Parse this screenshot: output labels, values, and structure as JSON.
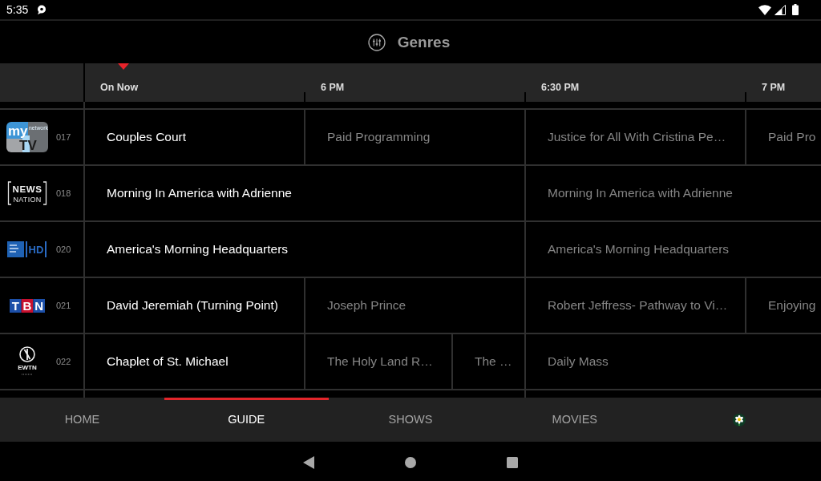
{
  "status_bar": {
    "time": "5:35"
  },
  "header": {
    "filter_label": "Genres"
  },
  "timeline": [
    {
      "label": "On Now"
    },
    {
      "label": "6 PM"
    },
    {
      "label": "6:30 PM"
    },
    {
      "label": "7 PM"
    }
  ],
  "channels": [
    {
      "number": "017",
      "logo": {
        "kind": "tile",
        "texts": [
          "my",
          "network",
          "TV"
        ]
      },
      "programs": [
        {
          "title": "Couples Court",
          "kind": "half",
          "airing": true
        },
        {
          "title": "Paid Programming",
          "kind": "half",
          "airing": false
        },
        {
          "title": "Justice for All With Cristina Pe…",
          "kind": "half",
          "airing": false
        },
        {
          "title": "Paid Pro",
          "kind": "open",
          "airing": false
        }
      ]
    },
    {
      "number": "018",
      "logo": {
        "kind": "frame",
        "texts": [
          "NEWS",
          "NATION"
        ]
      },
      "programs": [
        {
          "title": "Morning In America with Adrienne",
          "kind": "hour",
          "airing": true
        },
        {
          "title": "Morning In America with Adrienne",
          "kind": "open",
          "airing": false
        }
      ]
    },
    {
      "number": "020",
      "logo": {
        "kind": "bar",
        "texts": [
          "HD"
        ]
      },
      "programs": [
        {
          "title": "America's Morning Headquarters",
          "kind": "hour",
          "airing": true
        },
        {
          "title": "America's Morning Headquarters",
          "kind": "open",
          "airing": false
        }
      ]
    },
    {
      "number": "021",
      "logo": {
        "kind": "blocks",
        "texts": [
          "TBN"
        ]
      },
      "programs": [
        {
          "title": "David Jeremiah (Turning Point)",
          "kind": "half",
          "airing": true
        },
        {
          "title": "Joseph Prince",
          "kind": "half",
          "airing": false
        },
        {
          "title": "Robert Jeffress- Pathway to Vi…",
          "kind": "half",
          "airing": false
        },
        {
          "title": "Enjoying",
          "kind": "open",
          "airing": false
        }
      ]
    },
    {
      "number": "022",
      "logo": {
        "kind": "emblem",
        "texts": [
          "EWTN"
        ]
      },
      "programs": [
        {
          "title": "Chaplet of St. Michael",
          "kind": "half",
          "airing": true
        },
        {
          "title": "The Holy Land R…",
          "kind": "third",
          "airing": false
        },
        {
          "title": "The …",
          "kind": "sixth",
          "airing": false
        },
        {
          "title": "Daily Mass",
          "kind": "open",
          "airing": false
        }
      ]
    }
  ],
  "tabs": [
    {
      "kind": "label",
      "label": "HOME",
      "selected": false
    },
    {
      "kind": "label",
      "label": "GUIDE",
      "selected": true
    },
    {
      "kind": "label",
      "label": "SHOWS",
      "selected": false
    },
    {
      "kind": "label",
      "label": "MOVIES",
      "selected": false
    },
    {
      "kind": "avatar",
      "selected": false
    }
  ]
}
